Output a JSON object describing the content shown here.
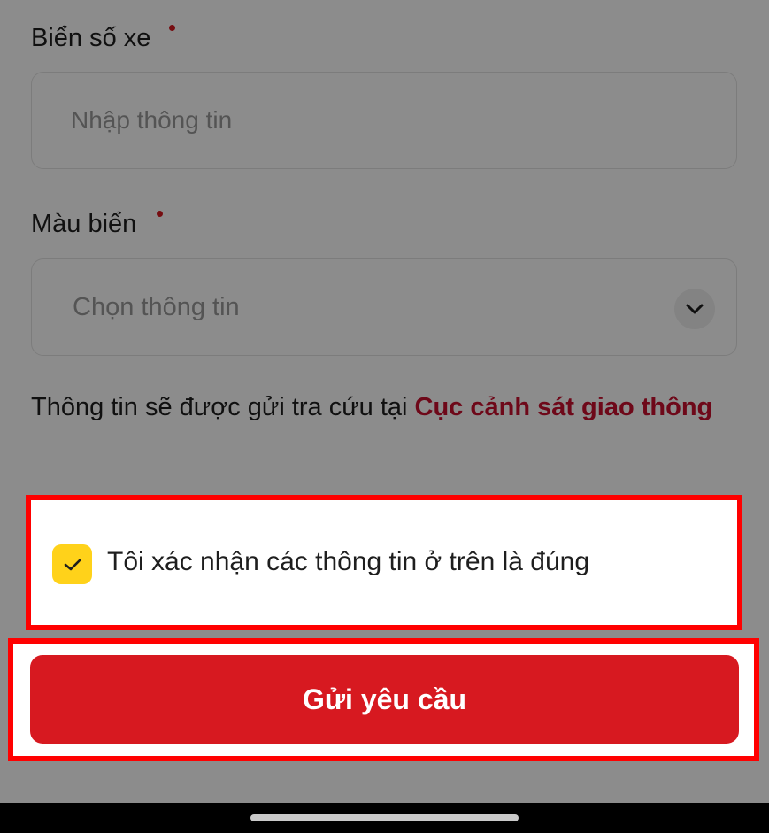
{
  "form": {
    "plate_number": {
      "label": "Biển số xe",
      "placeholder": "Nhập thông tin",
      "value": ""
    },
    "plate_color": {
      "label": "Màu biển",
      "placeholder": "Chọn thông tin"
    },
    "notice": {
      "text": "Thông tin sẽ được gửi tra cứu tại ",
      "link": "Cục cảnh sát giao thông"
    },
    "confirm": {
      "label": "Tôi xác nhận các thông tin ở trên là đúng",
      "checked": true
    },
    "submit_label": "Gửi yêu cầu"
  },
  "colors": {
    "brand_red": "#d71920",
    "checkbox_yellow": "#ffd21a",
    "highlight_border": "#ff0000"
  },
  "icons": {
    "required": "required-dot-icon",
    "dropdown": "chevron-down-icon",
    "check": "check-icon"
  }
}
